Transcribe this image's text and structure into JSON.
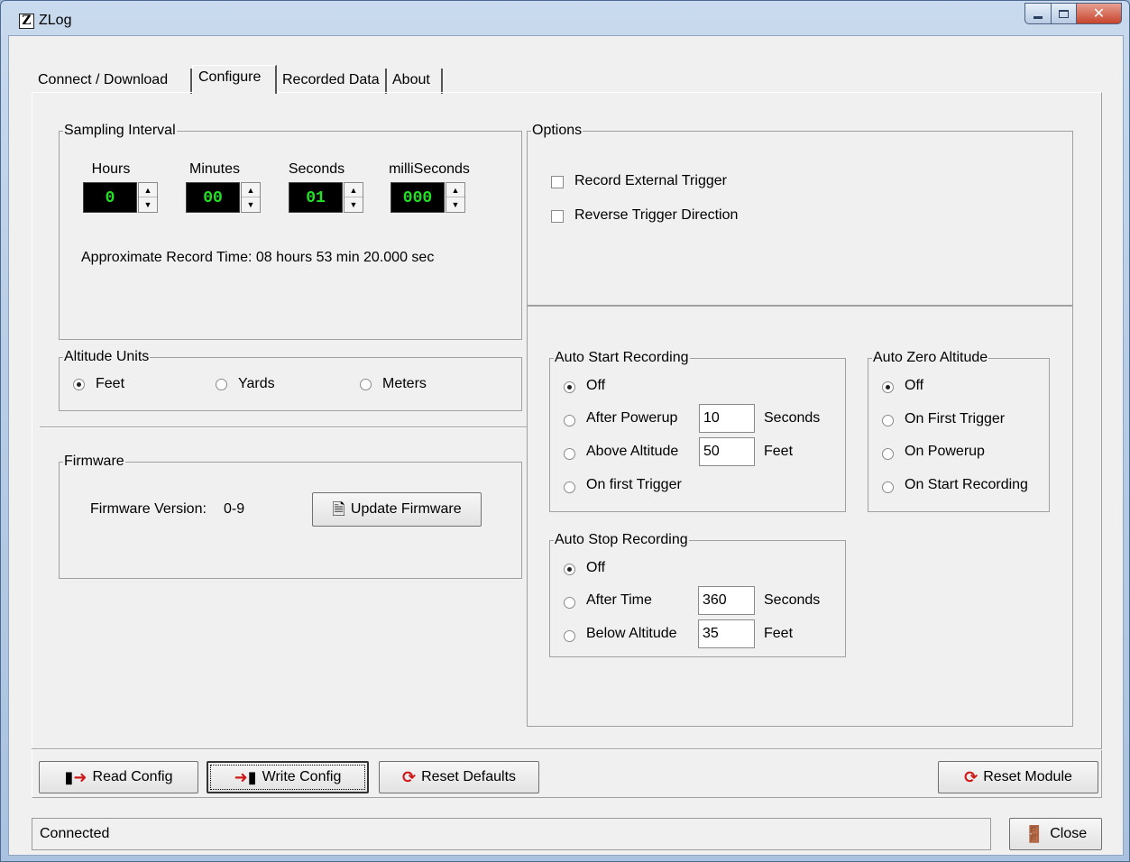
{
  "window": {
    "title": "ZLog",
    "icon_letter": "Z"
  },
  "tabs": [
    {
      "label": "Connect / Download"
    },
    {
      "label": "Configure"
    },
    {
      "label": "Recorded Data"
    },
    {
      "label": "About"
    }
  ],
  "sampling": {
    "title": "Sampling Interval",
    "hours_label": "Hours",
    "hours_value": "0",
    "minutes_label": "Minutes",
    "minutes_value": "00",
    "seconds_label": "Seconds",
    "seconds_value": "01",
    "ms_label": "milliSeconds",
    "ms_value": "000",
    "record_time": "Approximate Record Time: 08 hours 53 min 20.000 sec"
  },
  "altitude_units": {
    "title": "Altitude Units",
    "feet": "Feet",
    "yards": "Yards",
    "meters": "Meters",
    "selected": "Feet"
  },
  "firmware": {
    "title": "Firmware",
    "version_label": "Firmware Version:",
    "version_value": "0-9",
    "update_button": "Update Firmware"
  },
  "options": {
    "title": "Options",
    "record_external_trigger": "Record External Trigger",
    "reverse_trigger_direction": "Reverse Trigger Direction"
  },
  "auto_start": {
    "title": "Auto Start Recording",
    "off": "Off",
    "after_powerup": "After Powerup",
    "after_powerup_value": "10",
    "after_powerup_unit": "Seconds",
    "above_altitude": "Above Altitude",
    "above_altitude_value": "50",
    "above_altitude_unit": "Feet",
    "on_first_trigger": "On first Trigger",
    "selected": "Off"
  },
  "auto_zero": {
    "title": "Auto Zero Altitude",
    "off": "Off",
    "on_first_trigger": "On First Trigger",
    "on_powerup": "On Powerup",
    "on_start_recording": "On Start Recording",
    "selected": "Off"
  },
  "auto_stop": {
    "title": "Auto Stop Recording",
    "off": "Off",
    "after_time": "After Time",
    "after_time_value": "360",
    "after_time_unit": "Seconds",
    "below_altitude": "Below Altitude",
    "below_altitude_value": "35",
    "below_altitude_unit": "Feet",
    "selected": "Off"
  },
  "buttons": {
    "read_config": "Read Config",
    "write_config": "Write Config",
    "reset_defaults": "Reset Defaults",
    "reset_module": "Reset Module",
    "close": "Close"
  },
  "status": {
    "text": "Connected"
  },
  "colors": {
    "lcd_bg": "#000000",
    "lcd_text": "#22e022",
    "reset_icon": "#d01818"
  }
}
